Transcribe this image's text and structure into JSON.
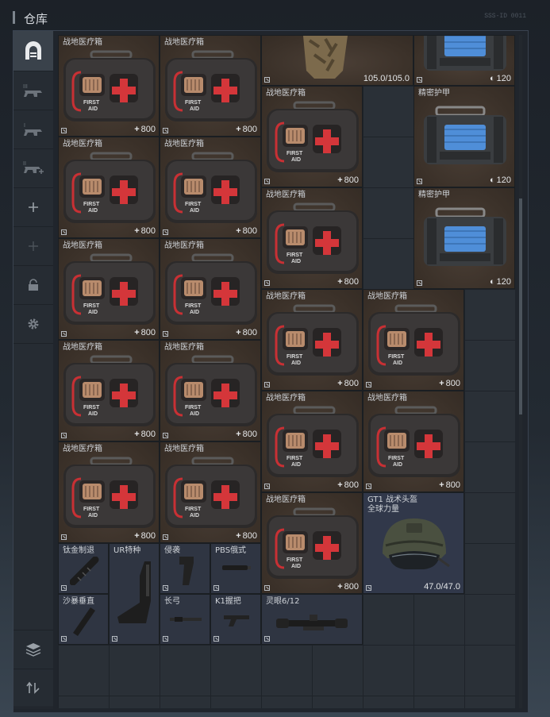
{
  "window": {
    "title": "仓库",
    "corner_text": "SSS-ID 0011"
  },
  "sidebar": {
    "buttons": [
      {
        "name": "storage-icon",
        "active": true
      },
      {
        "name": "loadout-3-icon",
        "active": false
      },
      {
        "name": "loadout-1-icon",
        "active": false
      },
      {
        "name": "loadout-2-add-icon",
        "active": false
      },
      {
        "name": "add-icon",
        "active": false
      },
      {
        "name": "add-disabled-icon",
        "active": false
      },
      {
        "name": "lock-icon",
        "active": false
      },
      {
        "name": "gear-icon",
        "active": false
      },
      {
        "name": "layers-icon",
        "active": false
      },
      {
        "name": "sort-icon",
        "active": false
      }
    ]
  },
  "items": {
    "medkit_label": "战地医疗箱",
    "medkit_value": "800",
    "armor_label": "精密护甲",
    "armor_value": "120",
    "top_item_value": "105.0/105.0",
    "helmet_label_1": "GT1 战术头盔",
    "helmet_label_2": "全球力量",
    "helmet_value": "47.0/47.0",
    "parts": {
      "titanium": "钛金制退",
      "ur": "UR特种",
      "raid": "侵袭",
      "pbs": "PBS俄式",
      "sandstorm": "沙暴垂直",
      "longbow": "长弓",
      "k1": "K1握把",
      "scope": "灵眼6/12"
    }
  },
  "colors": {
    "accent_blue": "#4f8ed8",
    "medkit_red": "#d4363a",
    "panel_brown": "#3b3129"
  }
}
